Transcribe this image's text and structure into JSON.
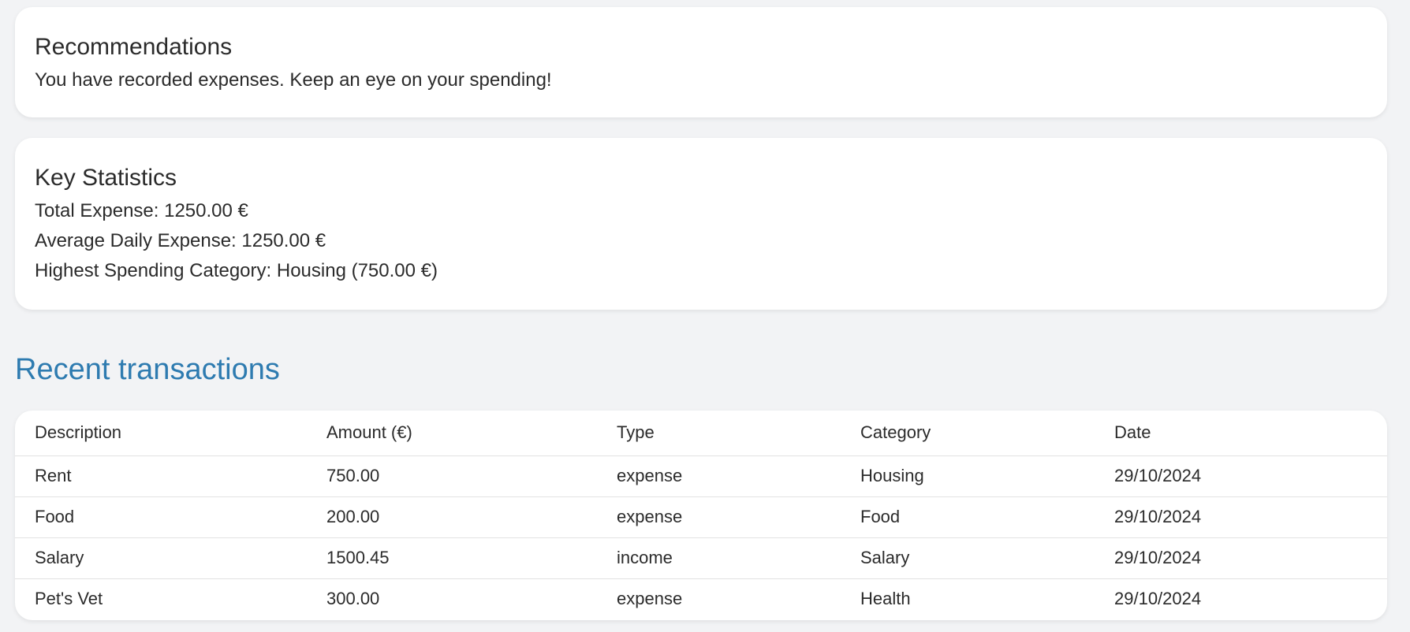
{
  "recommendations": {
    "title": "Recommendations",
    "text": "You have recorded expenses. Keep an eye on your spending!"
  },
  "statistics": {
    "title": "Key Statistics",
    "total_expense": "Total Expense: 1250.00 €",
    "average_daily_expense": "Average Daily Expense: 1250.00 €",
    "highest_category": "Highest Spending Category: Housing (750.00 €)"
  },
  "transactions": {
    "title": "Recent transactions",
    "columns": [
      "Description",
      "Amount (€)",
      "Type",
      "Category",
      "Date"
    ],
    "rows": [
      [
        "Rent",
        "750.00",
        "expense",
        "Housing",
        "29/10/2024"
      ],
      [
        "Food",
        "200.00",
        "expense",
        "Food",
        "29/10/2024"
      ],
      [
        "Salary",
        "1500.45",
        "income",
        "Salary",
        "29/10/2024"
      ],
      [
        "Pet's Vet",
        "300.00",
        "expense",
        "Health",
        "29/10/2024"
      ]
    ]
  },
  "colors": {
    "background": "#f2f3f5",
    "card": "#ffffff",
    "accent": "#2e7bb0",
    "text": "#2b2b2b"
  }
}
